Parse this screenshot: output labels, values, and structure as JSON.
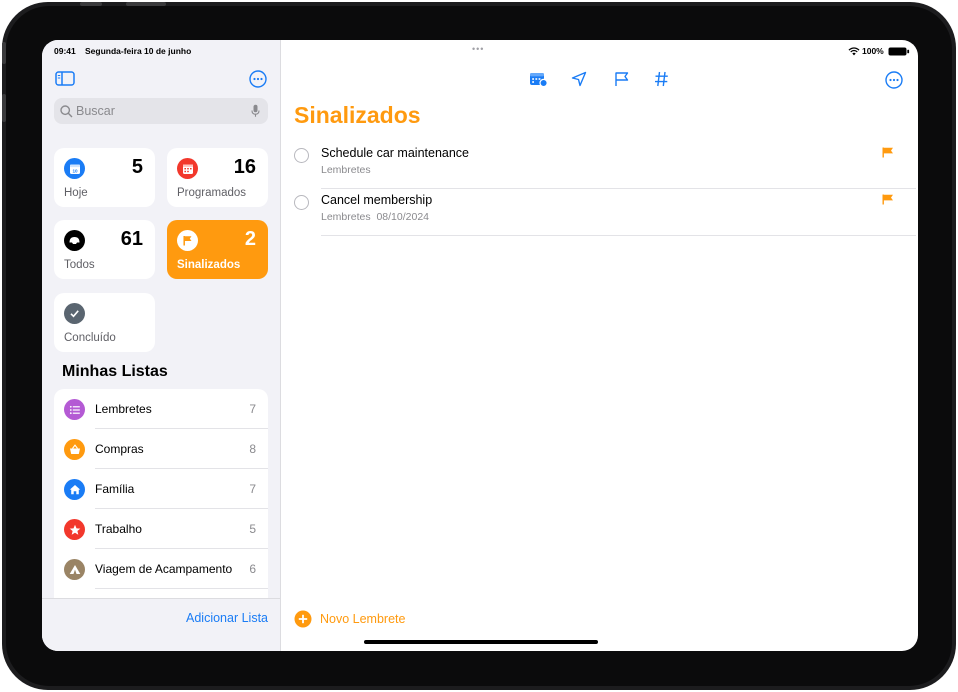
{
  "status_bar": {
    "time": "09:41",
    "date": "Segunda-feira 10 de junho",
    "battery": "100%",
    "multitask_dots": "•••"
  },
  "sidebar": {
    "search_placeholder": "Buscar",
    "smart_lists": [
      {
        "label": "Hoje",
        "count": "5",
        "icon": "calendar-today-icon",
        "color": "#1a7cf5"
      },
      {
        "label": "Programados",
        "count": "16",
        "icon": "calendar-grid-icon",
        "color": "#f2382c"
      },
      {
        "label": "Todos",
        "count": "61",
        "icon": "tray-icon",
        "color": "#000000"
      },
      {
        "label": "Sinalizados",
        "count": "2",
        "icon": "flag-icon",
        "color": "#ff9a0f",
        "selected": true
      },
      {
        "label": "Concluído",
        "count": "",
        "icon": "checkmark-icon",
        "color": "#5a6570"
      }
    ],
    "my_lists_title": "Minhas Listas",
    "my_lists": [
      {
        "label": "Lembretes",
        "count": "7",
        "icon": "list-bullet-icon",
        "color": "#b45ad4"
      },
      {
        "label": "Compras",
        "count": "8",
        "icon": "basket-icon",
        "color": "#ff9a0f"
      },
      {
        "label": "Família",
        "count": "7",
        "icon": "house-icon",
        "color": "#1a7cf5"
      },
      {
        "label": "Trabalho",
        "count": "5",
        "icon": "star-icon",
        "color": "#f2382c"
      },
      {
        "label": "Viagem de Acampamento",
        "count": "6",
        "icon": "tent-icon",
        "color": "#9a8465"
      }
    ],
    "add_list_label": "Adicionar Lista"
  },
  "main": {
    "title": "Sinalizados",
    "accent": "#ff9a0f",
    "toolbar_icons": [
      "calendar-badge-icon",
      "location-arrow-icon",
      "flag-outline-icon",
      "hashtag-icon"
    ],
    "tasks": [
      {
        "title": "Schedule car maintenance",
        "subtitle": "Lembretes",
        "flagged": true
      },
      {
        "title": "Cancel membership",
        "subtitle": "Lembretes  08/10/2024",
        "flagged": true
      }
    ],
    "new_reminder_label": "Novo Lembrete"
  }
}
